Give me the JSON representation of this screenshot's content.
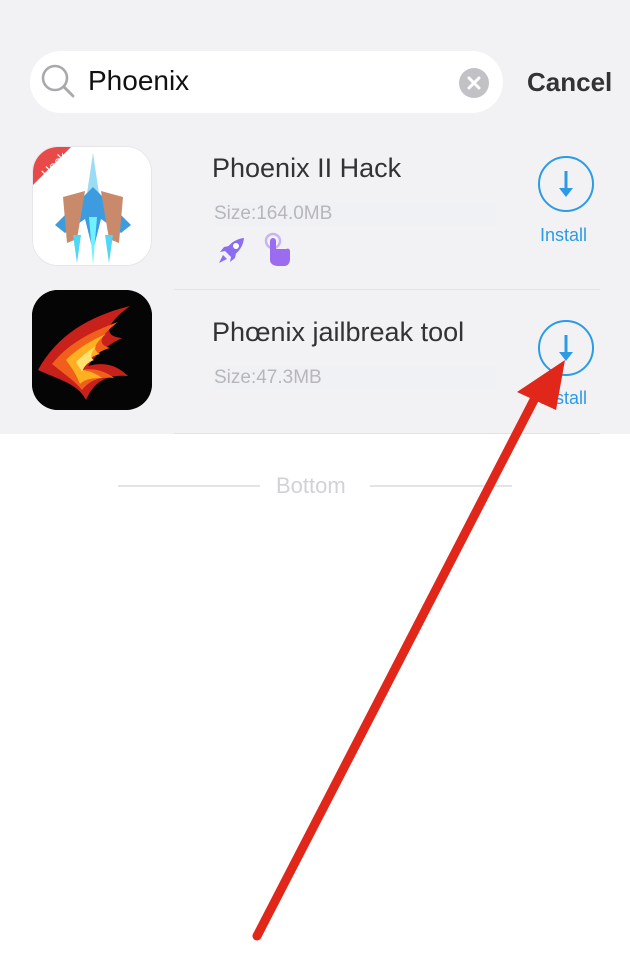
{
  "search": {
    "query": "Phoenix",
    "cancel_label": "Cancel"
  },
  "results": [
    {
      "name": "Phoenix II Hack",
      "size": "Size:164.0MB",
      "icon_ribbon": "Hack",
      "install_label": "Install",
      "badges": [
        "rocket-icon",
        "touch-icon"
      ]
    },
    {
      "name": "Phœnix jailbreak tool",
      "size": "Size:47.3MB",
      "install_label": "Install"
    }
  ],
  "footer": {
    "bottom_label": "Bottom"
  },
  "colors": {
    "accent": "#2b9be6",
    "header_bg": "#f2f2f5",
    "annotation_arrow": "#e0271a",
    "badge_purple": "#8a6df0"
  }
}
